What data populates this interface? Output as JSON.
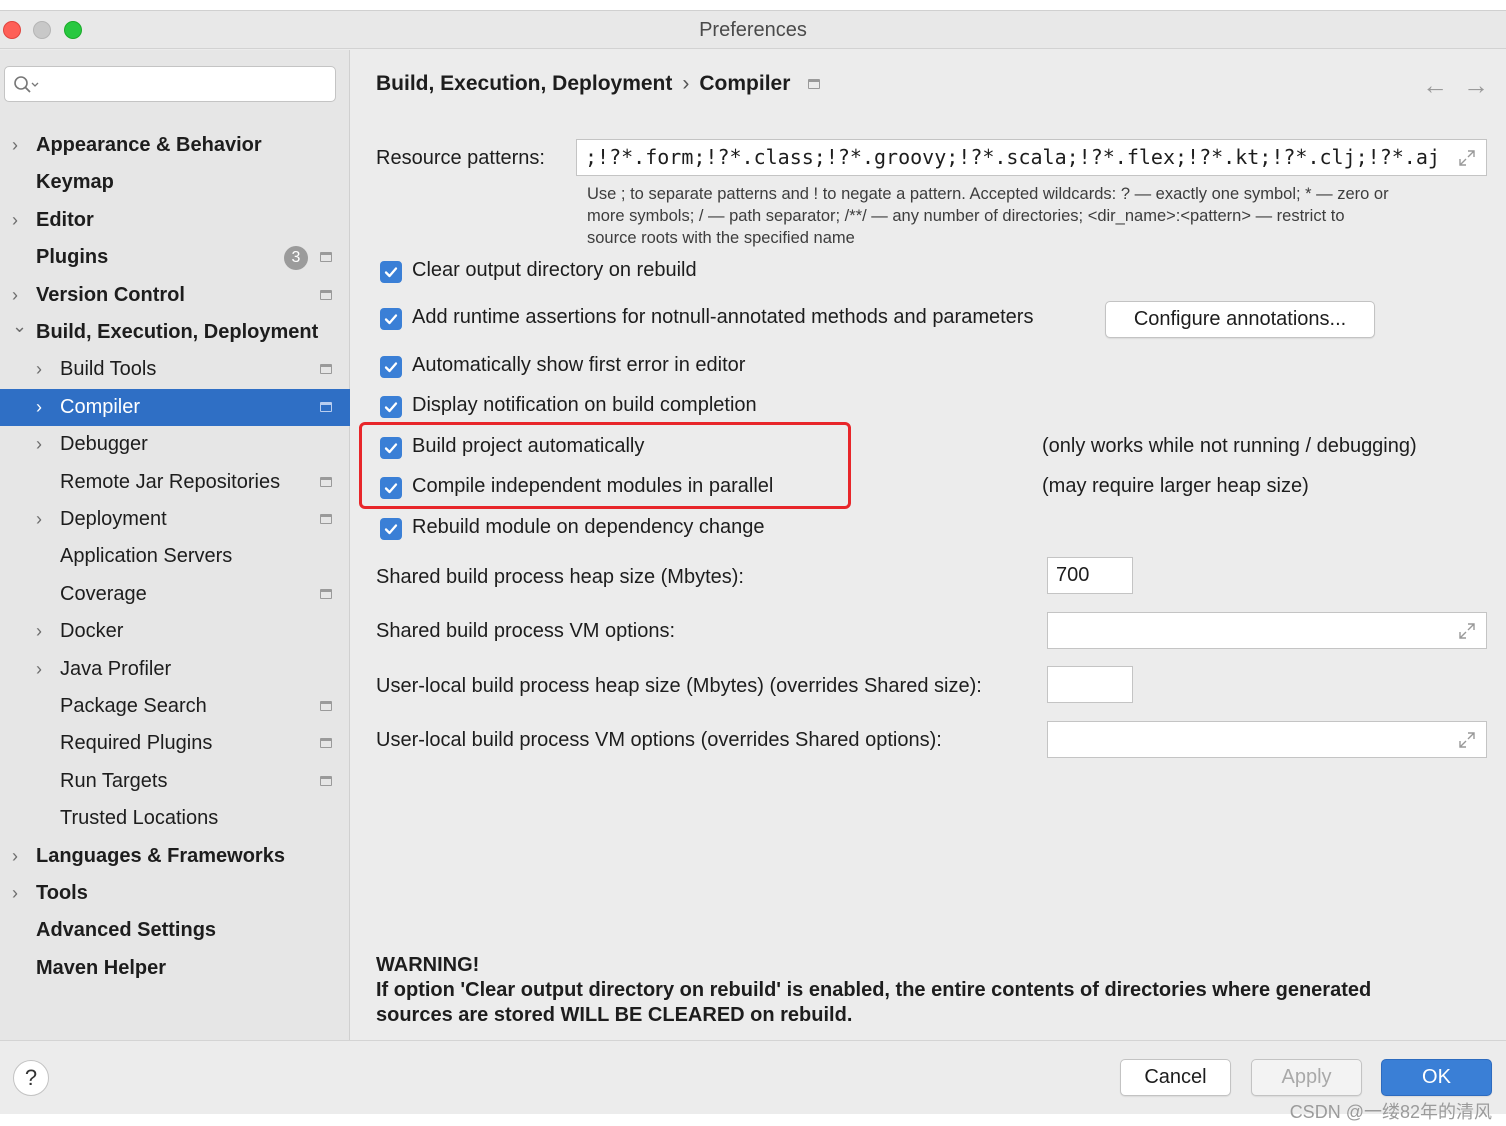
{
  "window": {
    "title": "Preferences"
  },
  "search": {
    "placeholder": ""
  },
  "sidebar": {
    "items": [
      {
        "label": "Appearance & Behavior",
        "level": 0,
        "expandable": true,
        "expanded": false,
        "mini_icon": false
      },
      {
        "label": "Keymap",
        "level": 0,
        "expandable": false,
        "mini_icon": false
      },
      {
        "label": "Editor",
        "level": 0,
        "expandable": true,
        "expanded": false,
        "mini_icon": false
      },
      {
        "label": "Plugins",
        "level": 0,
        "expandable": false,
        "mini_icon": true,
        "badge": "3"
      },
      {
        "label": "Version Control",
        "level": 0,
        "expandable": true,
        "expanded": false,
        "mini_icon": true
      },
      {
        "label": "Build, Execution, Deployment",
        "level": 0,
        "expandable": true,
        "expanded": true,
        "mini_icon": false
      },
      {
        "label": "Build Tools",
        "level": 1,
        "expandable": true,
        "expanded": false,
        "mini_icon": true
      },
      {
        "label": "Compiler",
        "level": 1,
        "expandable": true,
        "expanded": false,
        "mini_icon": true,
        "selected": true
      },
      {
        "label": "Debugger",
        "level": 1,
        "expandable": true,
        "expanded": false,
        "mini_icon": false
      },
      {
        "label": "Remote Jar Repositories",
        "level": 1,
        "expandable": false,
        "mini_icon": true
      },
      {
        "label": "Deployment",
        "level": 1,
        "expandable": true,
        "expanded": false,
        "mini_icon": true
      },
      {
        "label": "Application Servers",
        "level": 1,
        "expandable": false,
        "mini_icon": false
      },
      {
        "label": "Coverage",
        "level": 1,
        "expandable": false,
        "mini_icon": true
      },
      {
        "label": "Docker",
        "level": 1,
        "expandable": true,
        "expanded": false,
        "mini_icon": false
      },
      {
        "label": "Java Profiler",
        "level": 1,
        "expandable": true,
        "expanded": false,
        "mini_icon": false
      },
      {
        "label": "Package Search",
        "level": 1,
        "expandable": false,
        "mini_icon": true
      },
      {
        "label": "Required Plugins",
        "level": 1,
        "expandable": false,
        "mini_icon": true
      },
      {
        "label": "Run Targets",
        "level": 1,
        "expandable": false,
        "mini_icon": true
      },
      {
        "label": "Trusted Locations",
        "level": 1,
        "expandable": false,
        "mini_icon": false
      },
      {
        "label": "Languages & Frameworks",
        "level": 0,
        "expandable": true,
        "expanded": false,
        "mini_icon": false
      },
      {
        "label": "Tools",
        "level": 0,
        "expandable": true,
        "expanded": false,
        "mini_icon": false
      },
      {
        "label": "Advanced Settings",
        "level": 0,
        "expandable": false,
        "mini_icon": false
      },
      {
        "label": "Maven Helper",
        "level": 0,
        "expandable": false,
        "mini_icon": false
      }
    ]
  },
  "breadcrumb": {
    "parent": "Build, Execution, Deployment",
    "separator": "›",
    "current": "Compiler"
  },
  "nav": {
    "back": "←",
    "forward": "→"
  },
  "resource_patterns": {
    "label": "Resource patterns:",
    "value": ";!?*.form;!?*.class;!?*.groovy;!?*.scala;!?*.flex;!?*.kt;!?*.clj;!?*.aj",
    "hint_line1": "Use ; to separate patterns and ! to negate a pattern. Accepted wildcards: ? — exactly one symbol; * — zero or",
    "hint_line2": "more symbols; / — path separator; /**/ — any number of directories; <dir_name>:<pattern> — restrict to",
    "hint_line3": "source roots with the specified name"
  },
  "options": [
    {
      "label": "Clear output directory on rebuild",
      "checked": true
    },
    {
      "label": "Add runtime assertions for notnull-annotated methods and parameters",
      "checked": true
    },
    {
      "label": "Automatically show first error in editor",
      "checked": true
    },
    {
      "label": "Display notification on build completion",
      "checked": true
    },
    {
      "label": "Build project automatically",
      "checked": true,
      "note": "(only works while not running / debugging)"
    },
    {
      "label": "Compile independent modules in parallel",
      "checked": true,
      "note": "(may require larger heap size)"
    },
    {
      "label": "Rebuild module on dependency change",
      "checked": true
    }
  ],
  "configure_button": "Configure annotations...",
  "heap": {
    "label": "Shared build process heap size (Mbytes):",
    "value": "700"
  },
  "vm_options": {
    "label": "Shared build process VM options:",
    "value": ""
  },
  "user_heap": {
    "label": "User-local build process heap size (Mbytes) (overrides Shared size):",
    "value": ""
  },
  "user_vm": {
    "label": "User-local build process VM options (overrides Shared options):",
    "value": ""
  },
  "warning": {
    "title": "WARNING!",
    "line1": "If option 'Clear output directory on rebuild' is enabled, the entire contents of directories where generated",
    "line2": "sources are stored WILL BE CLEARED on rebuild."
  },
  "footer": {
    "help": "?",
    "cancel": "Cancel",
    "apply": "Apply",
    "ok": "OK"
  },
  "watermark": "CSDN @一缕82年的清风",
  "colors": {
    "accent": "#3a7fd6",
    "selection": "#2f6fc5",
    "highlight": "#e8262a"
  }
}
